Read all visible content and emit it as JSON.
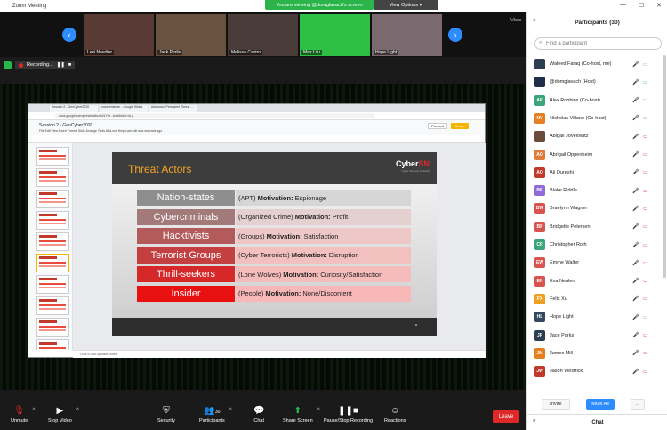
{
  "window": {
    "title": "Zoom Meeting",
    "minimize": "—",
    "maximize": "☐",
    "close": "✕"
  },
  "banner": {
    "viewing": "You are viewing @domglavach's screen",
    "view_options": "View Options ▾"
  },
  "strip": {
    "prev": "‹",
    "next": "›",
    "view": "View",
    "tiles": [
      {
        "name": "Lexi Needler",
        "bg": "#5a3a34"
      },
      {
        "name": "Jack Perlis",
        "bg": "#6a5240"
      },
      {
        "name": "Melissa Castro",
        "bg": "#4a3c38"
      },
      {
        "name": "Max Lifu",
        "bg": "#2ec044"
      },
      {
        "name": "Hope Light",
        "bg": "#7a6a70"
      }
    ]
  },
  "recording": {
    "label": "Recording..."
  },
  "browser": {
    "tabs": [
      "Session 2 - GenCyber2020",
      "cmd reminder - Google Slides",
      "Advanced Persistent Threat ..."
    ],
    "url": "docs.google.com/presentation/d/1Y3r.../edit#slide=id.p"
  },
  "doc": {
    "title": "Session 2 - GenCyber2020",
    "menu": "File  Edit  View  Insert  Format  Slide  Arrange  Tools  Add-ons  Help  Last edit was seconds ago",
    "present": "Present",
    "share": "Share",
    "speaker_notes": "Click to add speaker notes"
  },
  "slide": {
    "title": "Threat Actors",
    "logo_a": "Cyber",
    "logo_b": "SN",
    "logo_sub": "Cyber Security Network",
    "rows": [
      {
        "cat": "Nation-states",
        "pre": "(APT)",
        "mot": "Motivation:",
        "val": "Espionage",
        "cat_bg": "#8e8e8e",
        "desc_bg": "#d6d6d6"
      },
      {
        "cat": "Cybercriminals",
        "pre": "(Organized Crime)",
        "mot": "Motivation:",
        "val": "Profit",
        "cat_bg": "#a37a7a",
        "desc_bg": "#e5d0d0"
      },
      {
        "cat": "Hacktivists",
        "pre": "(Groups)",
        "mot": "Motivation:",
        "val": "Satisfaction",
        "cat_bg": "#b35a5a",
        "desc_bg": "#eec7c7"
      },
      {
        "cat": "Terrorist Groups",
        "pre": "(Cyber Terrorists)",
        "mot": "Motivation:",
        "val": "Disruption",
        "cat_bg": "#c44040",
        "desc_bg": "#f3c0c0"
      },
      {
        "cat": "Thrill-seekers",
        "pre": "(Lone Wolves)",
        "mot": "Motivation:",
        "val": "Curiosity/Satisfaction",
        "cat_bg": "#d62828",
        "desc_bg": "#f6bcbc"
      },
      {
        "cat": "Insider",
        "pre": "(People)",
        "mot": "Motivation:",
        "val": "None/Discontent",
        "cat_bg": "#e81010",
        "desc_bg": "#f8b8b8"
      }
    ]
  },
  "controls": {
    "unmute": "Unmute",
    "stop_video": "Stop Video",
    "security": "Security",
    "participants": "Participants",
    "participants_count": "30",
    "chat": "Chat",
    "share_screen": "Share Screen",
    "pause_recording": "Pause/Stop Recording",
    "reactions": "Reactions",
    "leave": "Leave"
  },
  "panel": {
    "title": "Participants (30)",
    "search_placeholder": "Find a participant",
    "participants": [
      {
        "initials": "",
        "name": "Waleed Faraq (Co-host, me)",
        "color": "#2c3e50",
        "cam": "grey",
        "mic": "grey"
      },
      {
        "initials": "",
        "name": "@domglavach (Host)",
        "color": "#1f2f4a",
        "cam": "green",
        "mic": "grey"
      },
      {
        "initials": "AR",
        "name": "Alex Robbins (Co-host)",
        "color": "#3aa57a",
        "cam": "grey",
        "mic": "red"
      },
      {
        "initials": "NV",
        "name": "Nicholas Villano (Co-host)",
        "color": "#e67e22",
        "cam": "grey",
        "mic": "red"
      },
      {
        "initials": "",
        "name": "Abigail Jovelowitz",
        "color": "#6b4b3a",
        "cam": "red",
        "mic": "red"
      },
      {
        "initials": "AO",
        "name": "Abrigail Oppenheim",
        "color": "#e07b39",
        "cam": "red",
        "mic": "red"
      },
      {
        "initials": "AQ",
        "name": "Ali Qureshi",
        "color": "#c0392b",
        "cam": "red",
        "mic": "red"
      },
      {
        "initials": "BR",
        "name": "Blake Riddle",
        "color": "#8e6bd6",
        "cam": "red",
        "mic": "red"
      },
      {
        "initials": "BW",
        "name": "Braelynn Wagner",
        "color": "#d9534f",
        "cam": "red",
        "mic": "red"
      },
      {
        "initials": "BP",
        "name": "Bridgette Petersen",
        "color": "#d9534f",
        "cam": "red",
        "mic": "red"
      },
      {
        "initials": "CR",
        "name": "Christopher Roth",
        "color": "#3aa57a",
        "cam": "red",
        "mic": "red"
      },
      {
        "initials": "EW",
        "name": "Emme  Walter",
        "color": "#d9534f",
        "cam": "red",
        "mic": "red"
      },
      {
        "initials": "EN",
        "name": "Eva Nealen",
        "color": "#d9534f",
        "cam": "red",
        "mic": "red"
      },
      {
        "initials": "FX",
        "name": "Felix Xu",
        "color": "#f0a020",
        "cam": "red",
        "mic": "red"
      },
      {
        "initials": "HL",
        "name": "Hope Light",
        "color": "#34495e",
        "cam": "grey",
        "mic": "red"
      },
      {
        "initials": "JP",
        "name": "Jace Parks",
        "color": "#2c3e50",
        "cam": "red",
        "mic": "red"
      },
      {
        "initials": "JM",
        "name": "James Mill",
        "color": "#e67e22",
        "cam": "red",
        "mic": "red"
      },
      {
        "initials": "JW",
        "name": "Jason Westrick",
        "color": "#c0392b",
        "cam": "red",
        "mic": "red"
      }
    ],
    "invite": "Invite",
    "mute_all": "Mute All",
    "more": "...",
    "chat": "Chat"
  },
  "colors": {
    "accent": "#2d8cff",
    "green": "#2bb44a",
    "red": "#e02828"
  }
}
